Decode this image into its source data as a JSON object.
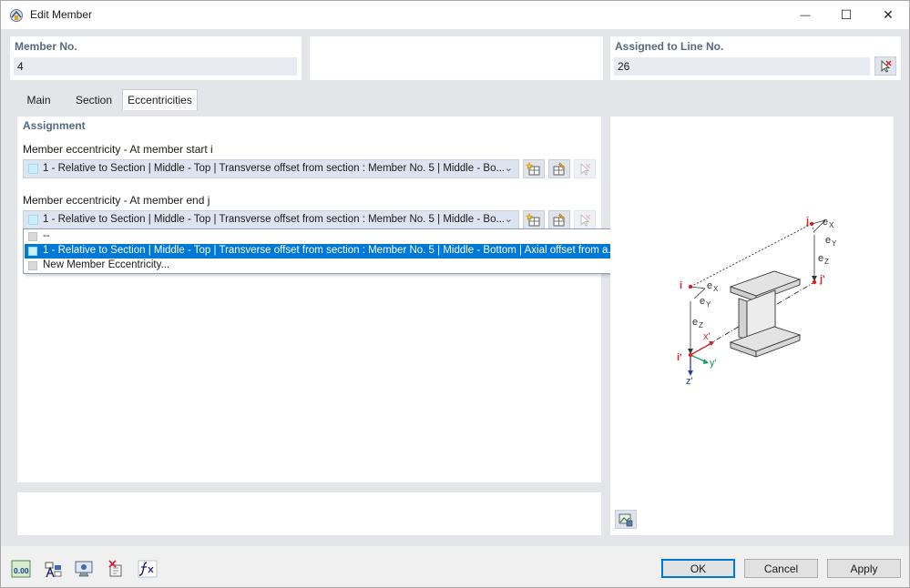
{
  "window": {
    "title": "Edit Member",
    "minimize_glyph": "—",
    "maximize_glyph": "☐",
    "close_glyph": "✕"
  },
  "header": {
    "member_no_label": "Member No.",
    "member_no_value": "4",
    "assigned_line_label": "Assigned to Line No.",
    "assigned_line_value": "26"
  },
  "tabs": [
    {
      "label": "Main"
    },
    {
      "label": "Section"
    },
    {
      "label": "Eccentricities"
    }
  ],
  "assignment": {
    "title": "Assignment",
    "start_label": "Member eccentricity - At member start i",
    "start_value": "1 - Relative to Section | Middle - Top | Transverse offset from section : Member No. 5 | Middle - Bo...",
    "end_label": "Member eccentricity - At member end j",
    "end_value": "1 - Relative to Section | Middle - Top | Transverse offset from section : Member No. 5 | Middle - Bo..."
  },
  "dropdown": {
    "items": [
      {
        "label": "--"
      },
      {
        "label": "1 - Relative to Section | Middle - Top | Transverse offset from section : Member No. 5 | Middle - Bottom | Axial offset from a..."
      },
      {
        "label": "New Member Eccentricity..."
      }
    ]
  },
  "diagram": {
    "labels": {
      "j": "j",
      "ex_top": "e",
      "ex_top_sub": "X",
      "ey_top": "e",
      "ey_top_sub": "Y",
      "ez_right": "e",
      "ez_right_sub": "Z",
      "j_prime": "j'",
      "i": "i",
      "ex_left": "e",
      "ex_left_sub": "X",
      "ey_left": "e",
      "ey_left_sub": "Y",
      "ez_left": "e",
      "ez_left_sub": "Z",
      "x_prime": "x'",
      "i_prime": "i'",
      "y_prime": "y'",
      "z_prime": "z'"
    },
    "colors": {
      "red": "#d9232a",
      "green": "#1a9a5a",
      "blue": "#2a3a9a",
      "gray": "#333333"
    }
  },
  "footer": {
    "ok_label": "OK",
    "cancel_label": "Cancel",
    "apply_label": "Apply",
    "icons": [
      "units-icon",
      "text-icon",
      "display-icon",
      "delete-icon",
      "formula-icon"
    ],
    "units_text": "0.00"
  }
}
